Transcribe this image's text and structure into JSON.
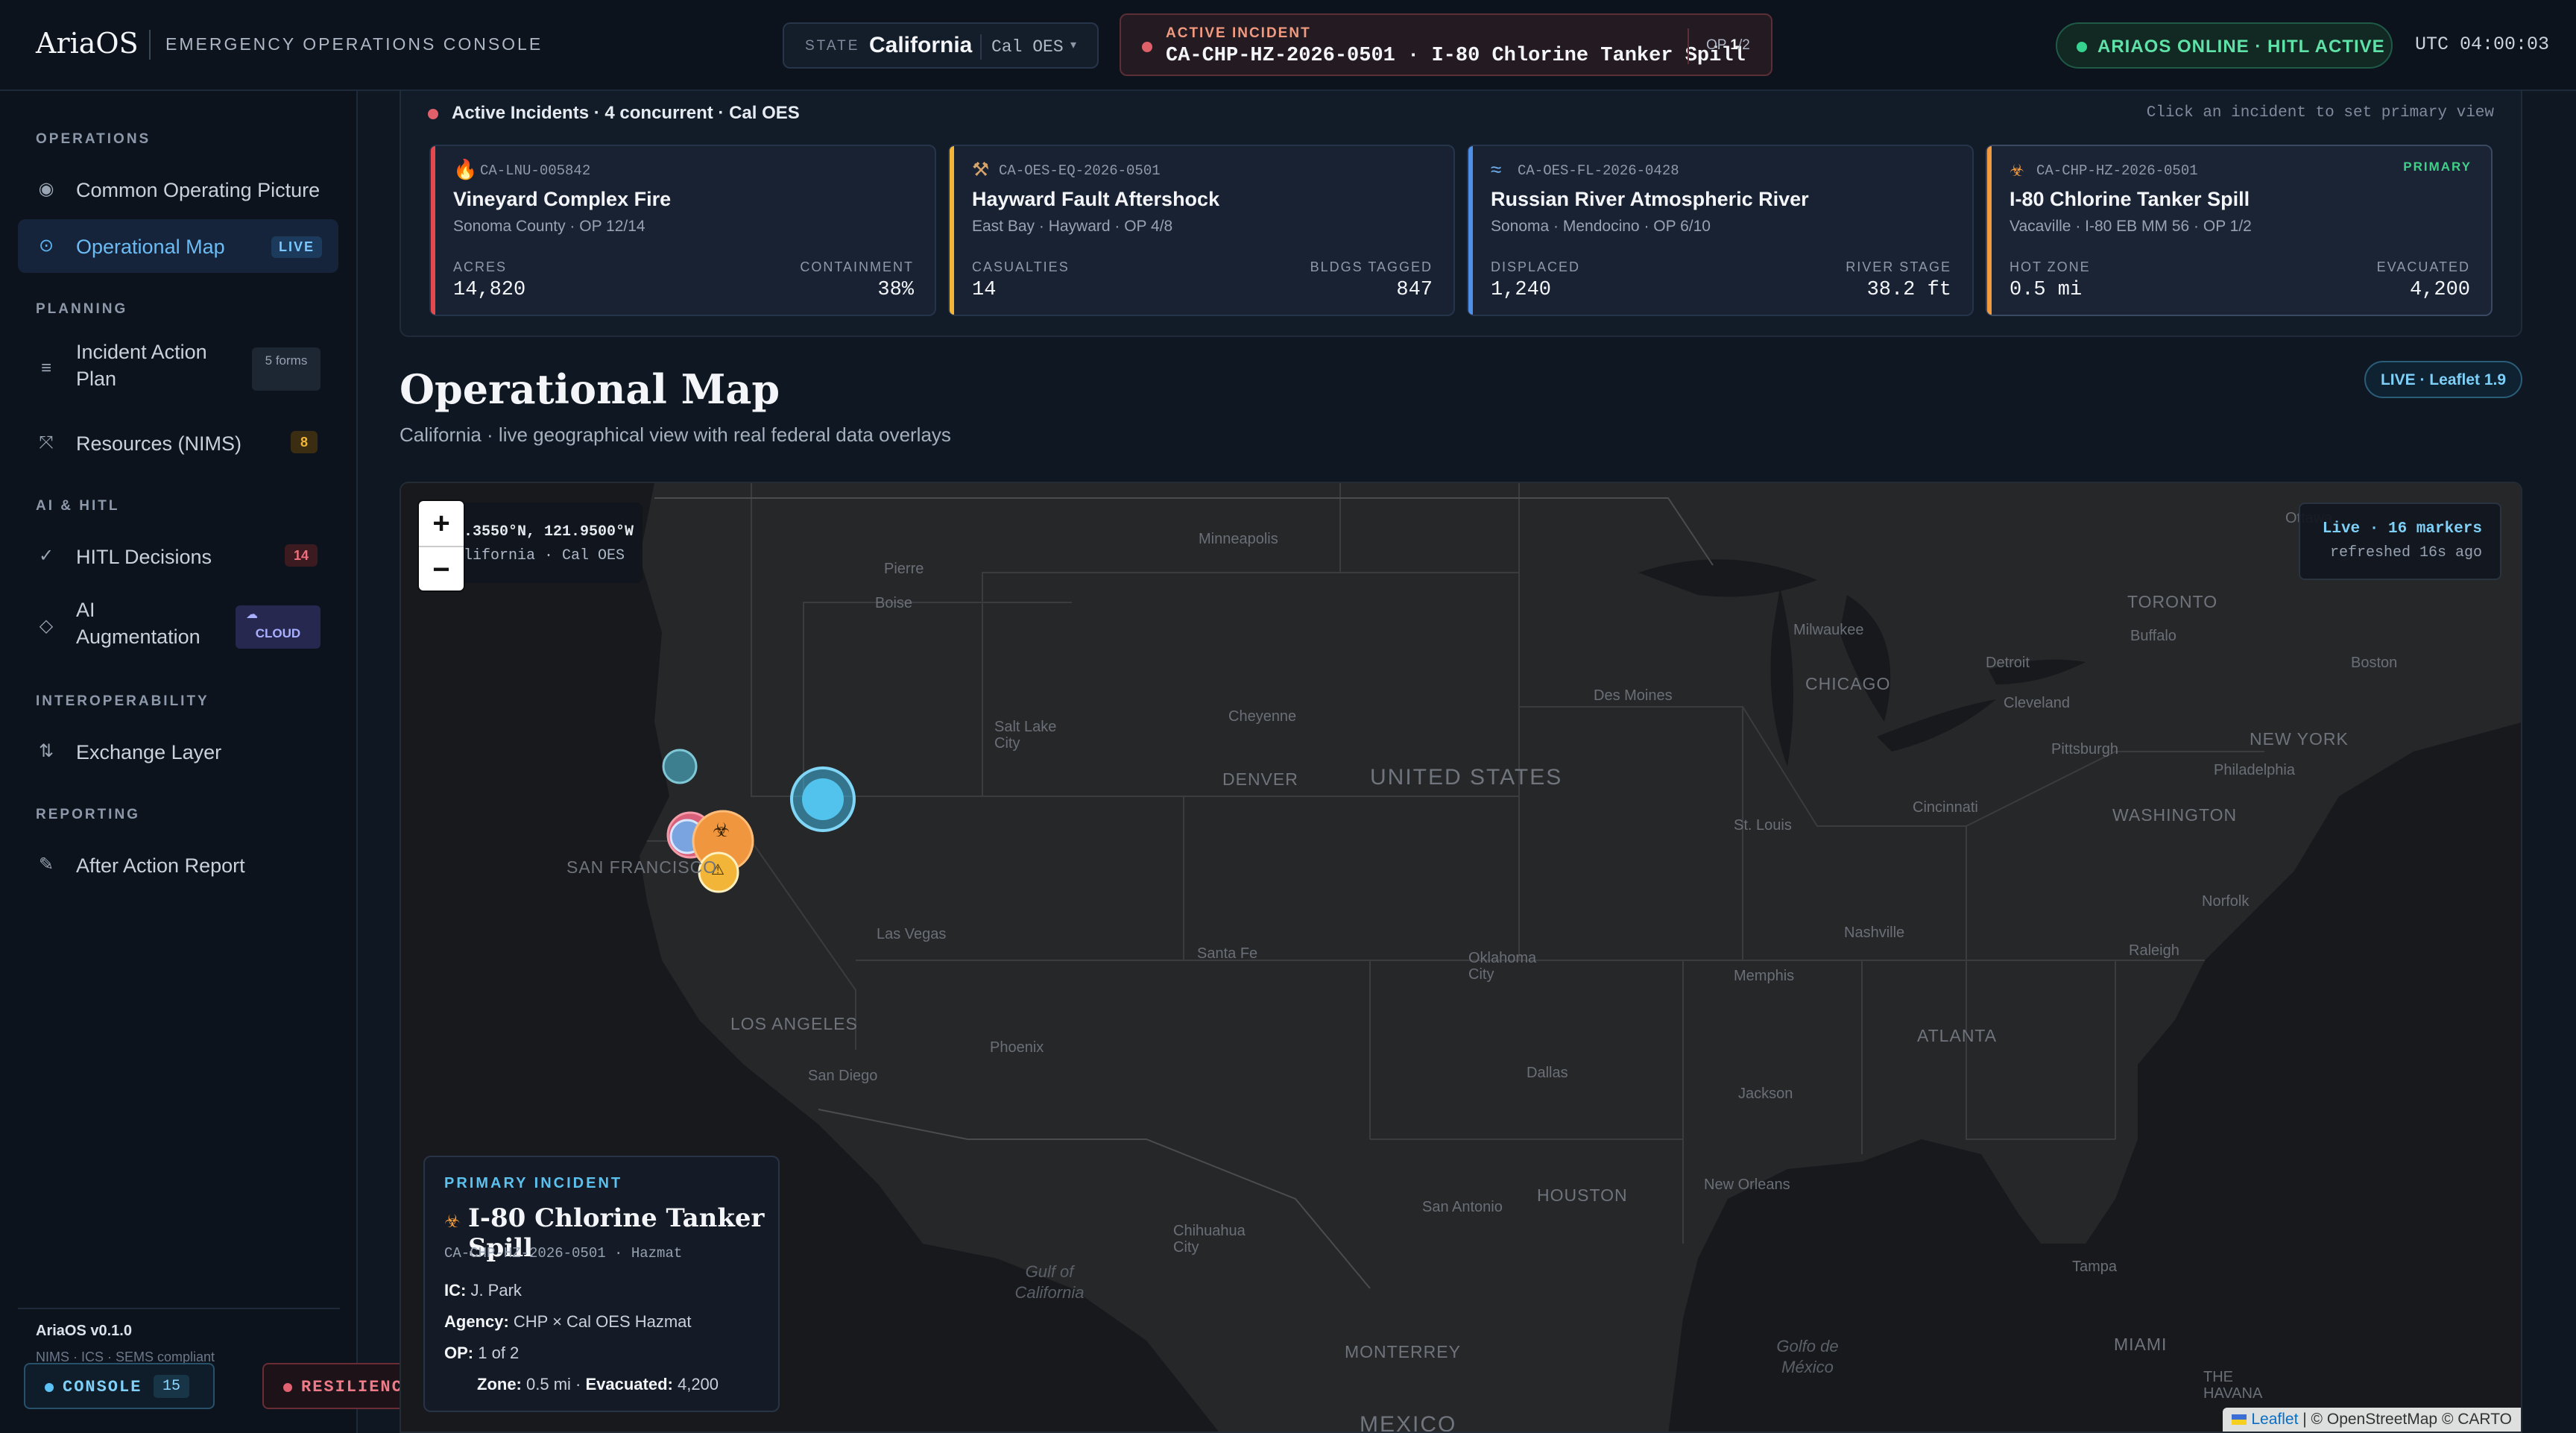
{
  "header": {
    "brand": "AriaOS",
    "subtitle": "EMERGENCY OPERATIONS CONSOLE",
    "state_label": "STATE",
    "state_value": "California",
    "state_org": "Cal OES",
    "incident_label": "ACTIVE INCIDENT",
    "incident_value": "CA-CHP-HZ-2026-0501 · I-80 Chlorine Tanker Spill",
    "op_prefix": "OP",
    "op_current": "1",
    "op_total": "/2",
    "status": "ARIAOS ONLINE · HITL ACTIVE",
    "utc": "UTC 04:00:03"
  },
  "sidebar": {
    "sections": {
      "operations": "OPERATIONS",
      "planning": "PLANNING",
      "ai": "AI & HITL",
      "interop": "INTEROPERABILITY",
      "reporting": "REPORTING"
    },
    "items": {
      "cop": "Common Operating Picture",
      "map": "Operational Map",
      "map_badge": "LIVE",
      "iap": "Incident Action Plan",
      "iap_badge": "5 forms",
      "resources": "Resources (NIMS)",
      "resources_badge": "8",
      "hitl": "HITL Decisions",
      "hitl_badge": "14",
      "ai": "AI Augmentation",
      "ai_badge": "CLOUD",
      "exchange": "Exchange Layer",
      "aar": "After Action Report"
    },
    "version": "AriaOS v0.1.0",
    "compliance": "NIMS · ICS · SEMS compliant",
    "console_label": "CONSOLE",
    "console_count": "15",
    "lab_label": "RESILIENCE LAB"
  },
  "incidents": {
    "header": "Active Incidents · 4 concurrent · Cal OES",
    "hint": "Click an incident to set primary view",
    "cards": [
      {
        "id": "CA-LNU-005842",
        "icon": "fire-icon",
        "title": "Vineyard Complex Fire",
        "sub": "Sonoma County · OP 12/14",
        "k1": "ACRES",
        "v1": "14,820",
        "k2": "CONTAINMENT",
        "v2": "38%",
        "color": "#e5484d"
      },
      {
        "id": "CA-OES-EQ-2026-0501",
        "icon": "earthquake-icon",
        "title": "Hayward Fault Aftershock",
        "sub": "East Bay · Hayward · OP 4/8",
        "k1": "CASUALTIES",
        "v1": "14",
        "k2": "BLDGS TAGGED",
        "v2": "847",
        "color": "#f2b538"
      },
      {
        "id": "CA-OES-FL-2026-0428",
        "icon": "flood-icon",
        "title": "Russian River Atmospheric River",
        "sub": "Sonoma · Mendocino · OP 6/10",
        "k1": "DISPLACED",
        "v1": "1,240",
        "k2": "RIVER STAGE",
        "v2": "38.2 ft",
        "color": "#4f8fe8"
      },
      {
        "id": "CA-CHP-HZ-2026-0501",
        "icon": "biohazard-icon",
        "title": "I-80 Chlorine Tanker Spill",
        "sub": "Vacaville · I-80 EB MM 56 · OP 1/2",
        "k1": "HOT ZONE",
        "v1": "0.5 mi",
        "k2": "EVACUATED",
        "v2": "4,200",
        "color": "#f29a3e",
        "primary": "PRIMARY"
      }
    ]
  },
  "map_section": {
    "title": "Operational Map",
    "subtitle": "California · live geographical view with real federal data overlays",
    "engine": "LIVE · Leaflet 1.9",
    "coord_line": ".3550°N, 121.9500°W",
    "coord_sub": "lifornia · Cal OES",
    "live_line": "Live · 16 markers",
    "live_sub": "refreshed 16s ago",
    "attribution_leaflet": "Leaflet",
    "attribution_rest": " | © OpenStreetMap © CARTO",
    "popup": {
      "tag": "PRIMARY INCIDENT",
      "title": "I-80 Chlorine Tanker Spill",
      "id": "CA-CHP-HZ-2026-0501 · Hazmat",
      "ic_label": "IC:",
      "ic": " J. Park",
      "agency_label": "Agency:",
      "agency": " CHP × Cal OES Hazmat",
      "op_label": "OP:",
      "op": " 1 of 2",
      "zone_label": "Zone:",
      "zone": " 0.5 mi · ",
      "evac_label": "Evacuated:",
      "evac": " 4,200"
    },
    "labels": {
      "minneapolis": "Minneapolis",
      "pierre": "Pierre",
      "boise": "Boise",
      "saltlake": "Salt Lake City",
      "cheyenne": "Cheyenne",
      "denver": "DENVER",
      "us": "UNITED STATES",
      "desmoines": "Des Moines",
      "milwaukee": "Milwaukee",
      "chicago": "CHICAGO",
      "detroit": "Detroit",
      "toronto": "TORONTO",
      "buffalo": "Buffalo",
      "ottawa": "Ottawa",
      "boston": "Boston",
      "cleveland": "Cleveland",
      "pittsburgh": "Pittsburgh",
      "newyork": "NEW YORK",
      "philadelphia": "Philadelphia",
      "washington": "WASHINGTON",
      "cincinnati": "Cincinnati",
      "stlouis": "St. Louis",
      "sanfrancisco": "SAN FRANCISCO",
      "lasvegas": "Las Vegas",
      "santafe": "Santa Fe",
      "oklahoma": "Oklahoma City",
      "nashville": "Nashville",
      "norfolk": "Norfolk",
      "raleigh": "Raleigh",
      "memphis": "Memphis",
      "losangeles": "LOS ANGELES",
      "phoenix": "Phoenix",
      "sandiego": "San Diego",
      "atlanta": "ATLANTA",
      "dallas": "Dallas",
      "jackson": "Jackson",
      "houston": "HOUSTON",
      "sanantonio": "San Antonio",
      "neworleans": "New Orleans",
      "chihuahua": "Chihuahua City",
      "tampa": "Tampa",
      "gulfcal": "Gulf of California",
      "monterrey": "MONTERREY",
      "miami": "MIAMI",
      "gulfmex": "Golfo de México",
      "mexico": "MEXICO",
      "havana": "THE HAVANA"
    }
  },
  "colors": {
    "accent": "#5cb2f0",
    "online": "#35d38f",
    "alert": "#e0606a",
    "primary": "#41cf8a"
  }
}
